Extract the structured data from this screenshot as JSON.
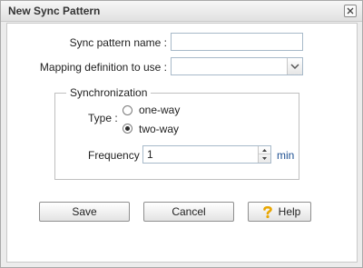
{
  "window": {
    "title": "New Sync Pattern"
  },
  "form": {
    "name_label": "Sync pattern name :",
    "name_value": "",
    "mapping_label": "Mapping definition to use :",
    "mapping_value": ""
  },
  "sync": {
    "legend": "Synchronization",
    "type_label": "Type :",
    "options": [
      {
        "label": "one-way",
        "checked": false
      },
      {
        "label": "two-way",
        "checked": true
      }
    ],
    "frequency_label": "Frequency :",
    "frequency_value": "1",
    "unit": "min"
  },
  "buttons": {
    "save": "Save",
    "cancel": "Cancel",
    "help": "Help"
  },
  "icons": {
    "close": "close-icon",
    "dropdown": "chevron-down-icon",
    "help": "question-mark-icon"
  }
}
